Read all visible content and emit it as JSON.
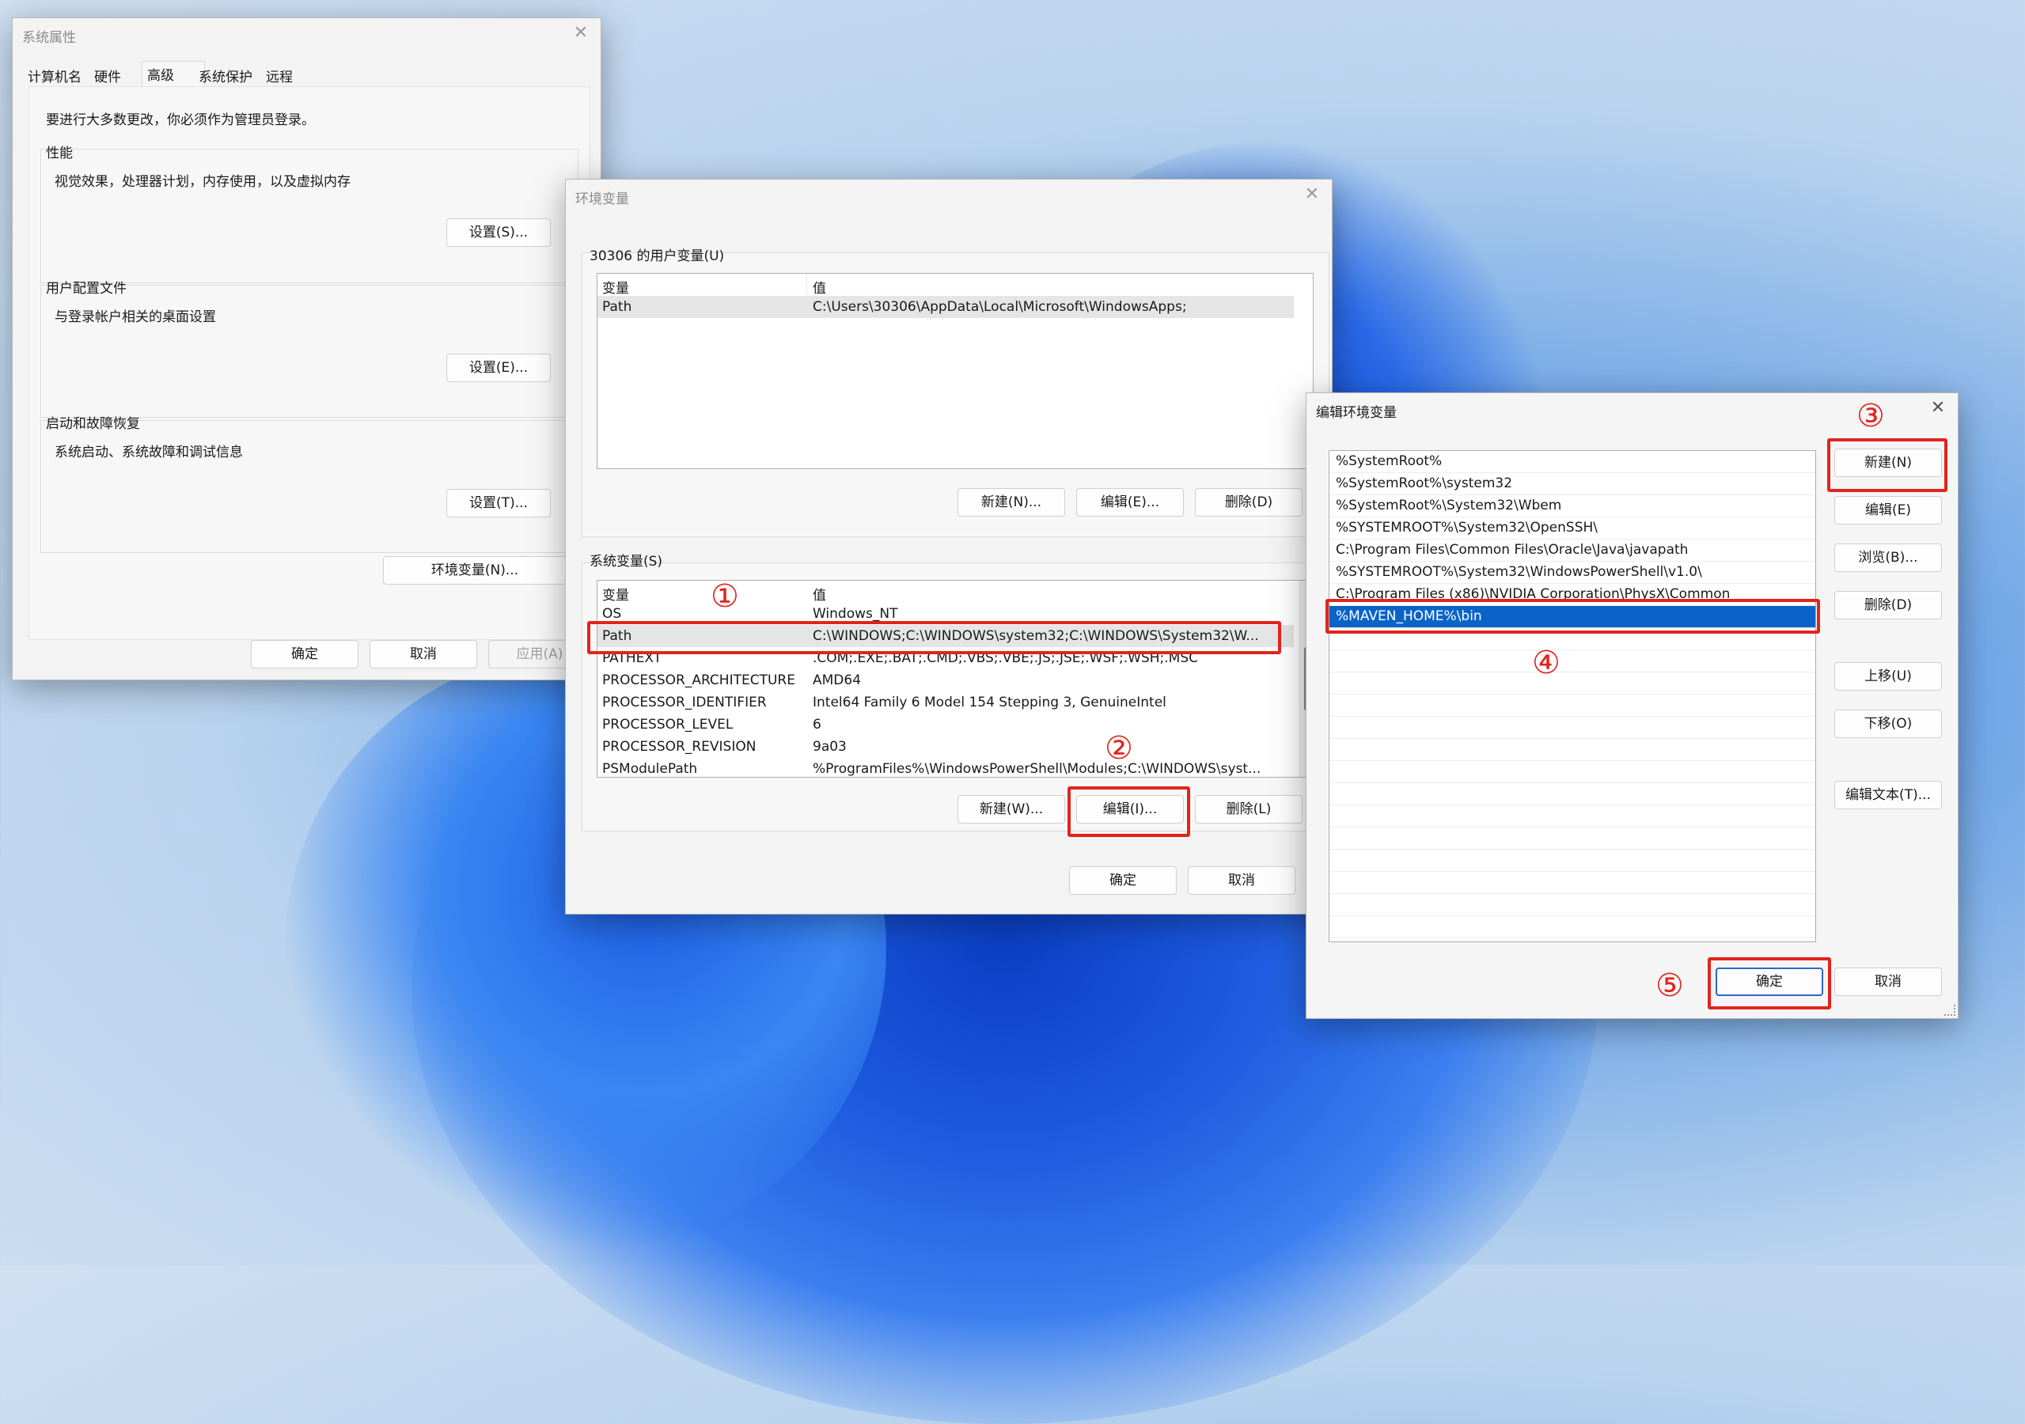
{
  "sysprops": {
    "title": "系统属性",
    "tabs": [
      "计算机名",
      "硬件",
      "高级",
      "系统保护",
      "远程"
    ],
    "admin_note": "要进行大多数更改，你必须作为管理员登录。",
    "perf": {
      "label": "性能",
      "desc": "视觉效果，处理器计划，内存使用，以及虚拟内存",
      "btn": "设置(S)..."
    },
    "profile": {
      "label": "用户配置文件",
      "desc": "与登录帐户相关的桌面设置",
      "btn": "设置(E)..."
    },
    "startup": {
      "label": "启动和故障恢复",
      "desc": "系统启动、系统故障和调试信息",
      "btn": "设置(T)..."
    },
    "env_btn": "环境变量(N)...",
    "ok": "确定",
    "cancel": "取消",
    "apply": "应用(A)"
  },
  "envvars": {
    "title": "环境变量",
    "user_label": "30306 的用户变量(U)",
    "col_var": "变量",
    "col_val": "值",
    "user_rows": [
      {
        "name": "Path",
        "value": "C:\\Users\\30306\\AppData\\Local\\Microsoft\\WindowsApps;"
      }
    ],
    "user_new": "新建(N)...",
    "user_edit": "编辑(E)...",
    "user_delete": "删除(D)",
    "sys_label": "系统变量(S)",
    "sys_rows": [
      {
        "name": "OS",
        "value": "Windows_NT"
      },
      {
        "name": "Path",
        "value": "C:\\WINDOWS;C:\\WINDOWS\\system32;C:\\WINDOWS\\System32\\W..."
      },
      {
        "name": "PATHEXT",
        "value": ".COM;.EXE;.BAT;.CMD;.VBS;.VBE;.JS;.JSE;.WSF;.WSH;.MSC"
      },
      {
        "name": "PROCESSOR_ARCHITECTURE",
        "value": "AMD64"
      },
      {
        "name": "PROCESSOR_IDENTIFIER",
        "value": "Intel64 Family 6 Model 154 Stepping 3, GenuineIntel"
      },
      {
        "name": "PROCESSOR_LEVEL",
        "value": "6"
      },
      {
        "name": "PROCESSOR_REVISION",
        "value": "9a03"
      },
      {
        "name": "PSModulePath",
        "value": "%ProgramFiles%\\WindowsPowerShell\\Modules;C:\\WINDOWS\\syst..."
      }
    ],
    "sys_new": "新建(W)...",
    "sys_edit": "编辑(I)...",
    "sys_delete": "删除(L)",
    "ok": "确定",
    "cancel": "取消"
  },
  "editenv": {
    "title": "编辑环境变量",
    "items": [
      "%SystemRoot%",
      "%SystemRoot%\\system32",
      "%SystemRoot%\\System32\\Wbem",
      "%SYSTEMROOT%\\System32\\OpenSSH\\",
      "C:\\Program Files\\Common Files\\Oracle\\Java\\javapath",
      "%SYSTEMROOT%\\System32\\WindowsPowerShell\\v1.0\\",
      "C:\\Program Files (x86)\\NVIDIA Corporation\\PhysX\\Common",
      "%MAVEN_HOME%\\bin"
    ],
    "new": "新建(N)",
    "edit": "编辑(E)",
    "browse": "浏览(B)...",
    "delete": "删除(D)",
    "up": "上移(U)",
    "down": "下移(O)",
    "edit_text": "编辑文本(T)...",
    "ok": "确定",
    "cancel": "取消"
  },
  "annotations": {
    "n1": "①",
    "n2": "②",
    "n3": "③",
    "n4": "④",
    "n5": "⑤"
  },
  "colors": {
    "highlight": "#e0241e",
    "selection": "#0a64c8"
  }
}
